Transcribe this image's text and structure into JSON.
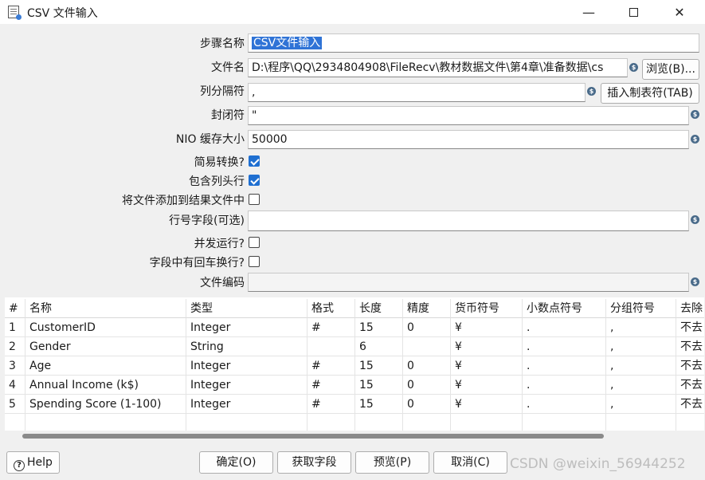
{
  "window": {
    "title": "CSV 文件输入",
    "minimize_glyph": "—",
    "close_glyph": "✕"
  },
  "form": {
    "step_name_label": "步骤名称",
    "step_name_value": "CSV文件输入",
    "filename_label": "文件名",
    "filename_value": "D:\\程序\\QQ\\2934804908\\FileRecv\\教材数据文件\\第4章\\准备数据\\cs",
    "browse_button": "浏览(B)...",
    "delimiter_label": "列分隔符",
    "delimiter_value": ",",
    "insert_tab_button": "插入制表符(TAB)",
    "enclosure_label": "封闭符",
    "enclosure_value": "\"",
    "nio_buffer_label": "NIO 缓存大小",
    "nio_buffer_value": "50000",
    "lazy_conversion_label": "简易转换?",
    "lazy_conversion_checked": true,
    "header_row_label": "包含列头行",
    "header_row_checked": true,
    "add_to_result_label": "将文件添加到结果文件中",
    "add_to_result_checked": false,
    "rownum_field_label": "行号字段(可选)",
    "rownum_field_value": "",
    "parallel_label": "并发运行?",
    "parallel_checked": false,
    "newlines_label": "字段中有回车换行?",
    "newlines_checked": false,
    "encoding_label": "文件编码",
    "encoding_value": "",
    "variable_icon_glyph": "$"
  },
  "table": {
    "columns": [
      "#",
      "名称",
      "类型",
      "格式",
      "长度",
      "精度",
      "货币符号",
      "小数点符号",
      "分组符号",
      "去除"
    ],
    "rows": [
      [
        "1",
        "CustomerID",
        "Integer",
        "#",
        "15",
        "0",
        "¥",
        ".",
        ",",
        "不去"
      ],
      [
        "2",
        "Gender",
        "String",
        "",
        "6",
        "",
        "¥",
        ".",
        ",",
        "不去"
      ],
      [
        "3",
        "Age",
        "Integer",
        "#",
        "15",
        "0",
        "¥",
        ".",
        ",",
        "不去"
      ],
      [
        "4",
        "Annual Income (k$)",
        "Integer",
        "#",
        "15",
        "0",
        "¥",
        ".",
        ",",
        "不去"
      ],
      [
        "5",
        "Spending Score (1-100)",
        "Integer",
        "#",
        "15",
        "0",
        "¥",
        ".",
        ",",
        "不去"
      ]
    ]
  },
  "footer": {
    "help_button": "Help",
    "help_icon_glyph": "?",
    "ok_button": "确定(O)",
    "get_fields_button": "获取字段",
    "preview_button": "预览(P)",
    "cancel_button": "取消(C)"
  },
  "watermark": "CSDN @weixin_56944252"
}
